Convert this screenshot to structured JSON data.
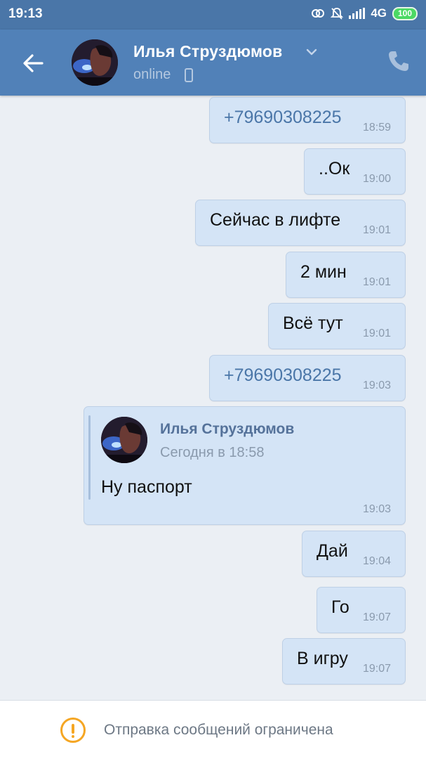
{
  "status_bar": {
    "time": "19:13",
    "network": "4G",
    "battery": "100"
  },
  "header": {
    "name": "Илья Струздюмов",
    "status": "online"
  },
  "messages": [
    {
      "text": "+79690308225",
      "time": "18:59",
      "is_link": true
    },
    {
      "text": "..Ок",
      "time": "19:00"
    },
    {
      "text": "Сейчас  в лифте",
      "time": "19:01"
    },
    {
      "text": "2 мин",
      "time": "19:01"
    },
    {
      "text": "Всё  тут",
      "time": "19:01"
    },
    {
      "text": "+79690308225",
      "time": "19:03",
      "is_link": true
    },
    {
      "forwarded": {
        "author": "Илья Струздюмов",
        "date": "Сегодня в 18:58",
        "text": "Ну паспорт"
      },
      "time": "19:03"
    },
    {
      "text": "Дай",
      "time": "19:04"
    },
    {
      "text": "Го",
      "time": "19:07"
    },
    {
      "text": "В игру",
      "time": "19:07"
    }
  ],
  "bottom": {
    "notice": "Отправка сообщений ограничена"
  },
  "colors": {
    "header": "#5181b8",
    "status_bar": "#4a76a8",
    "bubble": "#d4e4f6",
    "link": "#4a76a8",
    "warning": "#f5a623"
  },
  "icons": [
    "back-arrow-icon",
    "chevron-down-icon",
    "mobile-phone-icon",
    "call-icon",
    "warning-icon"
  ]
}
